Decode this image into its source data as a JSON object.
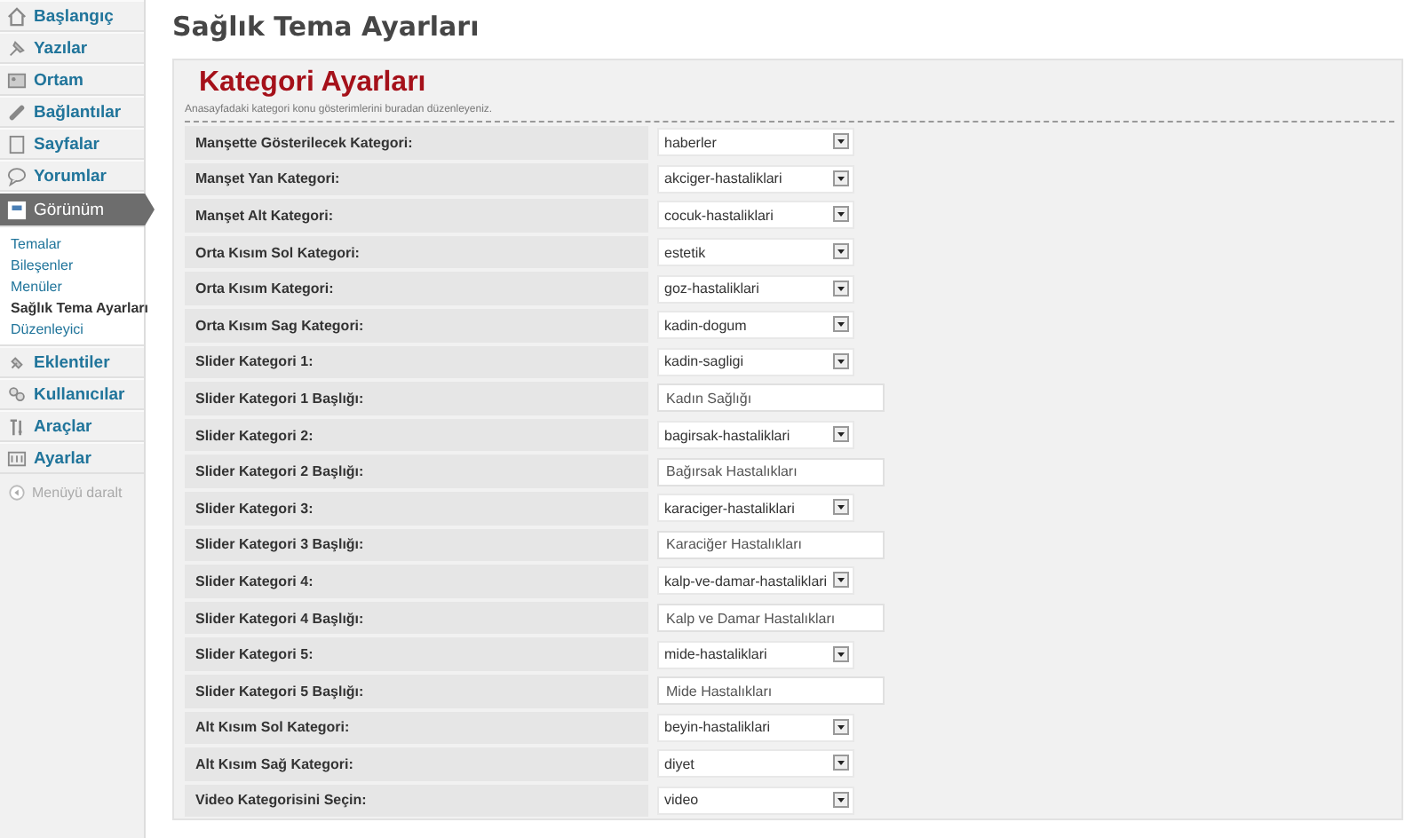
{
  "sidebar": {
    "items": [
      {
        "label": "Başlangıç",
        "selected": false
      },
      {
        "label": "Yazılar",
        "selected": false
      },
      {
        "label": "Ortam",
        "selected": false
      },
      {
        "label": "Bağlantılar",
        "selected": false
      },
      {
        "label": "Sayfalar",
        "selected": false
      },
      {
        "label": "Yorumlar",
        "selected": false
      },
      {
        "label": "Görünüm",
        "selected": true,
        "children": [
          {
            "label": "Temalar",
            "selected": false
          },
          {
            "label": "Bileşenler",
            "selected": false
          },
          {
            "label": "Menüler",
            "selected": false
          },
          {
            "label": "Sağlık Tema Ayarları",
            "selected": true
          },
          {
            "label": "Düzenleyici",
            "selected": false
          }
        ]
      },
      {
        "label": "Eklentiler",
        "selected": false
      },
      {
        "label": "Kullanıcılar",
        "selected": false
      },
      {
        "label": "Araçlar",
        "selected": false
      },
      {
        "label": "Ayarlar",
        "selected": false
      }
    ],
    "collapse_label": "Menüyü daralt"
  },
  "page_title": "Sağlık Tema Ayarları",
  "panel": {
    "title": "Kategori Ayarları",
    "description": "Anasayfadaki kategori konu gösterimlerini buradan düzenleyeniz.",
    "rows": [
      {
        "label": "Manşette Gösterilecek Kategori:",
        "kind": "select",
        "value": "haberler"
      },
      {
        "label": "Manşet Yan Kategori:",
        "kind": "select",
        "value": "akciger-hastaliklari"
      },
      {
        "label": "Manşet Alt Kategori:",
        "kind": "select",
        "value": "cocuk-hastaliklari"
      },
      {
        "label": "Orta Kısım Sol Kategori:",
        "kind": "select",
        "value": "estetik"
      },
      {
        "label": "Orta Kısım Kategori:",
        "kind": "select",
        "value": "goz-hastaliklari"
      },
      {
        "label": "Orta Kısım Sag Kategori:",
        "kind": "select",
        "value": "kadin-dogum"
      },
      {
        "label": "Slider Kategori 1:",
        "kind": "select",
        "value": "kadin-sagligi"
      },
      {
        "label": "Slider Kategori 1 Başlığı:",
        "kind": "text",
        "value": "Kadın Sağlığı"
      },
      {
        "label": "Slider Kategori 2:",
        "kind": "select",
        "value": "bagirsak-hastaliklari"
      },
      {
        "label": "Slider Kategori 2 Başlığı:",
        "kind": "text",
        "value": "Bağırsak Hastalıkları"
      },
      {
        "label": "Slider Kategori 3:",
        "kind": "select",
        "value": "karaciger-hastaliklari"
      },
      {
        "label": "Slider Kategori 3 Başlığı:",
        "kind": "text",
        "value": "Karaciğer Hastalıkları"
      },
      {
        "label": "Slider Kategori 4:",
        "kind": "select",
        "value": "kalp-ve-damar-hastaliklari"
      },
      {
        "label": "Slider Kategori 4 Başlığı:",
        "kind": "text",
        "value": "Kalp ve Damar Hastalıkları"
      },
      {
        "label": "Slider Kategori 5:",
        "kind": "select",
        "value": "mide-hastaliklari"
      },
      {
        "label": "Slider Kategori 5 Başlığı:",
        "kind": "text",
        "value": "Mide Hastalıkları"
      },
      {
        "label": "Alt Kısım Sol Kategori:",
        "kind": "select",
        "value": "beyin-hastaliklari"
      },
      {
        "label": "Alt Kısım Sağ Kategori:",
        "kind": "select",
        "value": "diyet"
      },
      {
        "label": "Video Kategorisini Seçin:",
        "kind": "select",
        "value": "video"
      }
    ]
  }
}
